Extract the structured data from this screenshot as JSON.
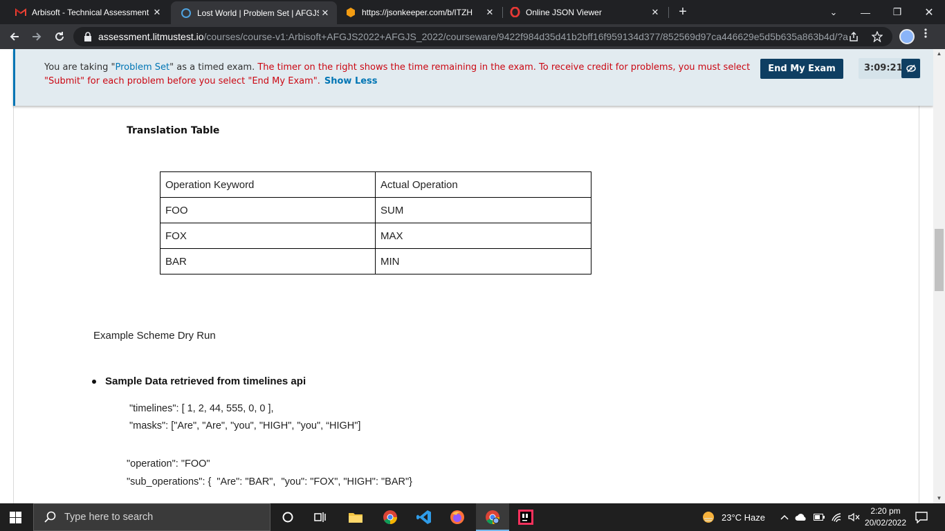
{
  "browser": {
    "tabs": [
      {
        "title": "Arbisoft - Technical Assessment -",
        "icon": "gmail-icon",
        "active": false
      },
      {
        "title": "Lost World | Problem Set | AFGJS",
        "icon": "edx-icon",
        "active": true
      },
      {
        "title": "https://jsonkeeper.com/b/ITZH",
        "icon": "jsonkeeper-icon",
        "active": false
      },
      {
        "title": "Online JSON Viewer",
        "icon": "opera-icon",
        "active": false
      }
    ],
    "close_glyph": "✕",
    "new_tab_glyph": "+",
    "window_controls": {
      "dropdown": "⌄",
      "minimize": "—",
      "restore": "❐",
      "close": "✕"
    },
    "url": {
      "host": "assessment.litmustest.io",
      "path": "/courses/course-v1:Arbisoft+AFGJS2022+AFGJS_2022/courseware/9422f984d35d41b2bff16f959134d377/852569d97ca446629e5d5b635a863b4d/?ac..."
    }
  },
  "exam_banner": {
    "part1": "You are taking \"",
    "exam_type": "Problem Set",
    "part2": "\" as a timed exam. ",
    "warning": "The timer on the right shows the time remaining in the exam. To receive credit for problems, you must select \"Submit\" for each problem before you select \"End My Exam\".",
    "show_less": "Show Less",
    "end_exam_label": "End My Exam",
    "timer": "3:09:21"
  },
  "content": {
    "translation_heading": "Translation Table",
    "table": {
      "headers": [
        "Operation Keyword",
        "Actual Operation"
      ],
      "rows": [
        [
          "FOO",
          "SUM"
        ],
        [
          "FOX",
          "MAX"
        ],
        [
          "BAR",
          "MIN"
        ]
      ]
    },
    "dry_run_heading": "Example Scheme Dry Run",
    "bullet": "Sample Data retrieved from timelines api",
    "code": {
      "timelines": "\"timelines\": [ 1, 2, 44, 555, 0, 0 ],",
      "masks": "\"masks\": [\"Are\", \"Are\", \"you\", \"HIGH\", \"you\", “HIGH\"]",
      "operation": "\"operation\": \"FOO\"",
      "sub_operations": "\"sub_operations\": {  \"Are\": \"BAR\",  \"you\": \"FOX\", \"HIGH\": \"BAR\"}"
    }
  },
  "taskbar": {
    "search_placeholder": "Type here to search",
    "weather": "23°C  Haze",
    "time": "2:20 pm",
    "date": "20/02/2022",
    "pinned": [
      "cortana-icon",
      "task-view-icon",
      "file-explorer-icon",
      "chrome-icon",
      "vscode-icon",
      "firefox-icon",
      "chrome-profile-icon",
      "intellij-icon"
    ]
  },
  "colors": {
    "accent": "#0075b4",
    "warning": "#cb0712",
    "end_exam_bg": "#0e3e62",
    "banner_bg": "#e2ebf0"
  }
}
